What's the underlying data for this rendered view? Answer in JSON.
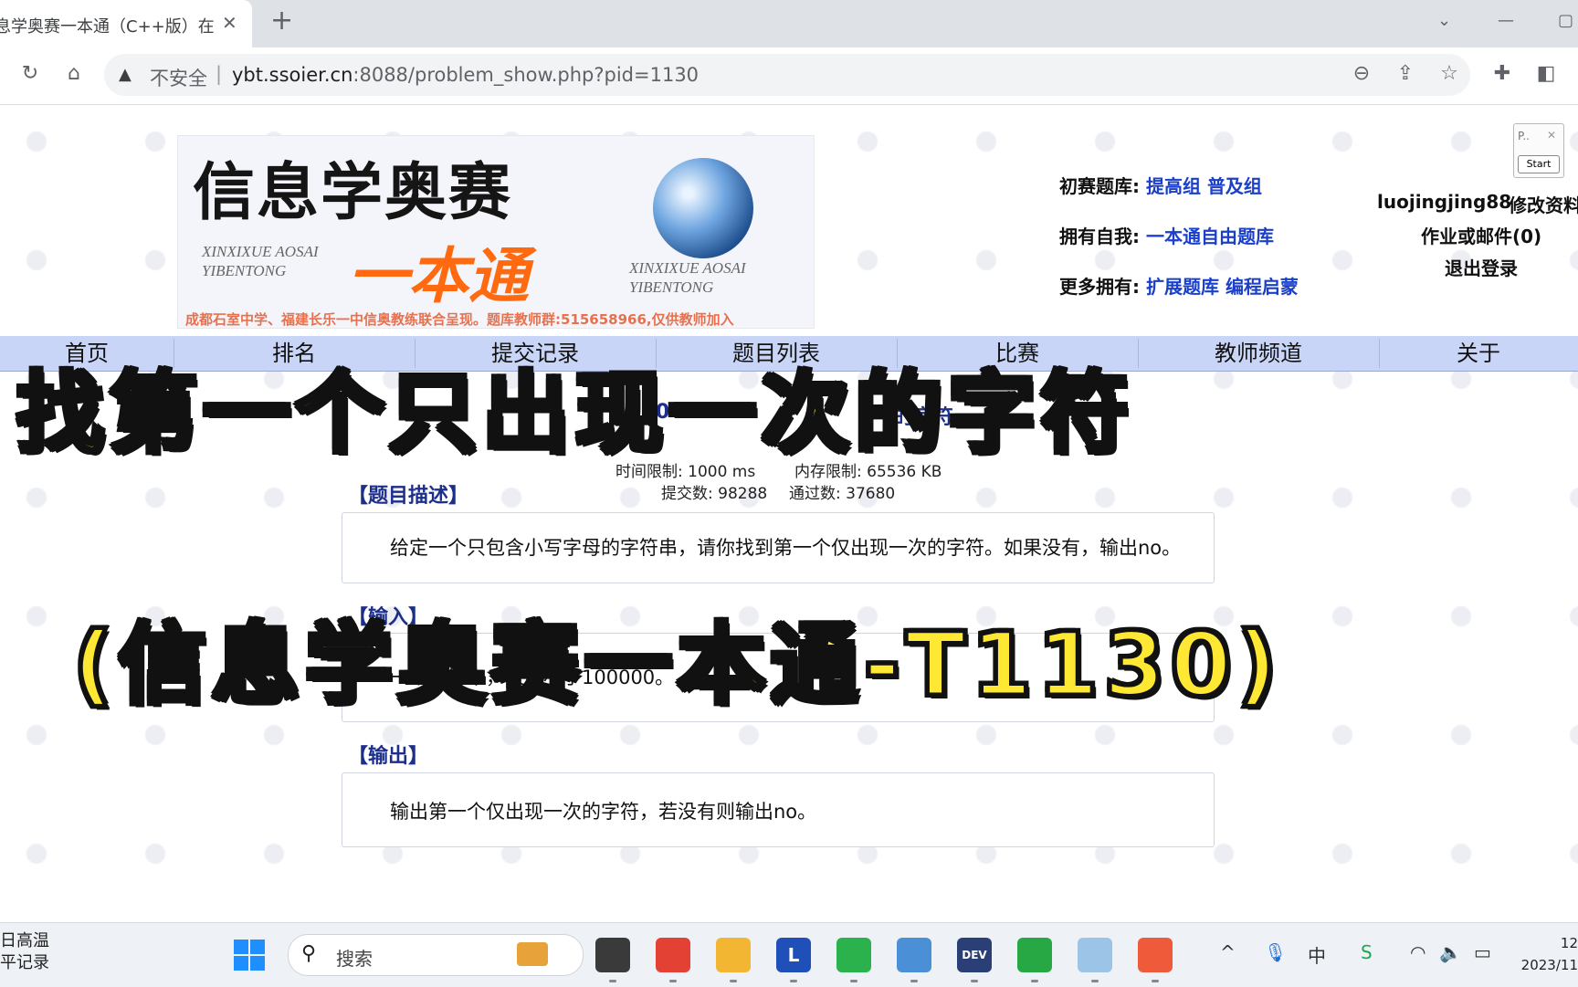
{
  "browser": {
    "tab_title": "息学奥赛一本通（C++版）在",
    "tab_close": "✕",
    "new_tab": "+",
    "warning_icon": "▲",
    "insecure_label": "不安全",
    "url_host": "ybt.ssoier.cn",
    "url_rest": ":8088/problem_show.php?pid=1130"
  },
  "banner": {
    "logo_title": "信息学奥赛",
    "logo_pinyin_left": [
      "XINXIXUE AOSAI",
      "YIBENTONG"
    ],
    "logo_pinyin_right": [
      "XINXIXUE AOSAI",
      "YIBENTONG"
    ],
    "logo_ybt": "一本通",
    "note": "成都石室中学、福建长乐一中信奥教练联合呈现。题库教师群:515658966,仅供教师加入"
  },
  "links": {
    "row1_label": "初赛题库:",
    "row1_links": [
      "提高组",
      "普及组"
    ],
    "row2_label": "拥有自我:",
    "row2_links": [
      "一本通自由题库"
    ],
    "row3_label": "更多拥有:",
    "row3_links": [
      "扩展题库",
      "编程启蒙"
    ]
  },
  "user": {
    "name": "luojingjing88",
    "edit": "修改资料",
    "mail": "作业或邮件(0)",
    "logout": "退出登录"
  },
  "widget": {
    "text": "P..",
    "close": "✕",
    "start": "Start"
  },
  "nav": [
    "首页",
    "排名",
    "提交记录",
    "题目列表",
    "比赛",
    "教师频道",
    "关于"
  ],
  "problem": {
    "id_fragment": "1130",
    "title_fragment": "的字符",
    "time_limit": "时间限制: 1000 ms",
    "memory_limit": "内存限制: 65536 KB",
    "submissions": "提交数: 98288",
    "accepted": "通过数: 37680",
    "desc_title": "【题目描述】",
    "desc_text": "给定一个只包含小写字母的字符串，请你找到第一个仅出现一次的字符。如果没有，输出no。",
    "input_title": "【输入】",
    "input_text": "一个字符串，长度小于100000。",
    "output_title": "【输出】",
    "output_text": "输出第一个仅出现一次的字符，若没有则输出no。"
  },
  "overlay": {
    "line1": "找第一个只出现一次的字符",
    "line2": "(信息学奥赛一本通-T1130)"
  },
  "taskbar": {
    "weather": [
      "日高温",
      "平记录"
    ],
    "search_placeholder": "搜索",
    "apps": [
      {
        "name": "task-view",
        "label": "",
        "color": "#3a3a3a"
      },
      {
        "name": "chrome",
        "label": "",
        "color": "#e34133"
      },
      {
        "name": "file-explorer",
        "label": "",
        "color": "#f2b632"
      },
      {
        "name": "l-app",
        "label": "L",
        "color": "#1f4fb8"
      },
      {
        "name": "wechat",
        "label": "",
        "color": "#2bb24c"
      },
      {
        "name": "notepad",
        "label": "",
        "color": "#4b8fd6"
      },
      {
        "name": "dev-cpp",
        "label": "DEV",
        "color": "#2b3f77"
      },
      {
        "name": "green-app",
        "label": "",
        "color": "#27a845"
      },
      {
        "name": "paint",
        "label": "",
        "color": "#9bc4e6"
      },
      {
        "name": "recorder",
        "label": "",
        "color": "#ee5a3a"
      }
    ],
    "ime": "中",
    "clock_time": "12",
    "clock_date": "2023/11"
  }
}
